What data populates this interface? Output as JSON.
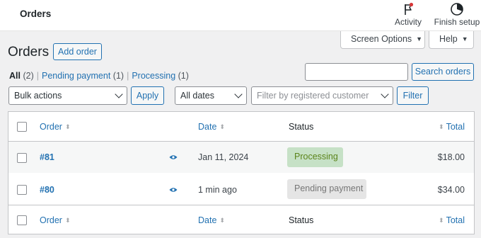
{
  "header": {
    "title": "Orders",
    "activity_label": "Activity",
    "finish_setup_label": "Finish setup",
    "activity_badge_color": "#d63638"
  },
  "screen_options": {
    "label": "Screen Options"
  },
  "help": {
    "label": "Help"
  },
  "page": {
    "heading": "Orders",
    "add_order_label": "Add order"
  },
  "views": [
    {
      "label": "All",
      "count": "(2)",
      "current": true
    },
    {
      "label": "Pending payment",
      "count": "(1)",
      "current": false
    },
    {
      "label": "Processing",
      "count": "(1)",
      "current": false
    }
  ],
  "search": {
    "value": "",
    "button_label": "Search orders"
  },
  "filters": {
    "bulk_actions": "Bulk actions",
    "apply_label": "Apply",
    "dates": "All dates",
    "customer_placeholder": "Filter by registered customer",
    "filter_label": "Filter"
  },
  "table": {
    "columns": {
      "order": "Order",
      "date": "Date",
      "status": "Status",
      "total": "Total"
    },
    "rows": [
      {
        "order": "#81",
        "date": "Jan 11, 2024",
        "status": "Processing",
        "total": "$18.00"
      },
      {
        "order": "#80",
        "date": "1 min ago",
        "status": "Pending payment",
        "total": "$34.00"
      }
    ]
  },
  "colors": {
    "accent": "#2271b1",
    "processing_bg": "#c6e1c6",
    "processing_text": "#5b841b",
    "pending_bg": "#e5e5e5",
    "pending_text": "#777777"
  },
  "icons": {
    "activity": "flag-icon",
    "finish_setup": "progress-circle-icon",
    "preview": "eye-icon",
    "sort": "sort-arrows-icon"
  }
}
